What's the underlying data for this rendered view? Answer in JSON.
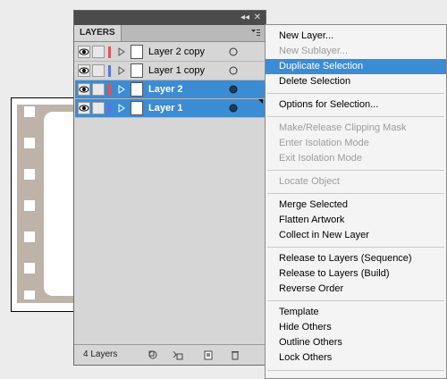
{
  "panel": {
    "tab_label": "LAYERS",
    "collapse_icon": "double-arrow-icon",
    "close_icon": "close-icon",
    "layers": [
      {
        "name": "Layer 2 copy",
        "color": "#e05454",
        "selected": false
      },
      {
        "name": "Layer 1 copy",
        "color": "#5b74e0",
        "selected": false
      },
      {
        "name": "Layer 2",
        "color": "#e05454",
        "selected": true
      },
      {
        "name": "Layer 1",
        "color": "#5b74e0",
        "selected": true
      }
    ],
    "footer_count": "4 Layers"
  },
  "menu": {
    "new_layer": "New Layer...",
    "new_sublayer": "New Sublayer...",
    "duplicate_selection": "Duplicate Selection",
    "delete_selection": "Delete Selection",
    "options_for_selection": "Options for Selection...",
    "make_release_clipping_mask": "Make/Release Clipping Mask",
    "enter_isolation_mode": "Enter Isolation Mode",
    "exit_isolation_mode": "Exit Isolation Mode",
    "locate_object": "Locate Object",
    "merge_selected": "Merge Selected",
    "flatten_artwork": "Flatten Artwork",
    "collect_in_new_layer": "Collect in New Layer",
    "release_to_layers_sequence": "Release to Layers (Sequence)",
    "release_to_layers_build": "Release to Layers (Build)",
    "reverse_order": "Reverse Order",
    "template": "Template",
    "hide_others": "Hide Others",
    "outline_others": "Outline Others",
    "lock_others": "Lock Others"
  },
  "colors": {
    "selection": "#3b8cd3",
    "film": "#bdb3a8"
  }
}
